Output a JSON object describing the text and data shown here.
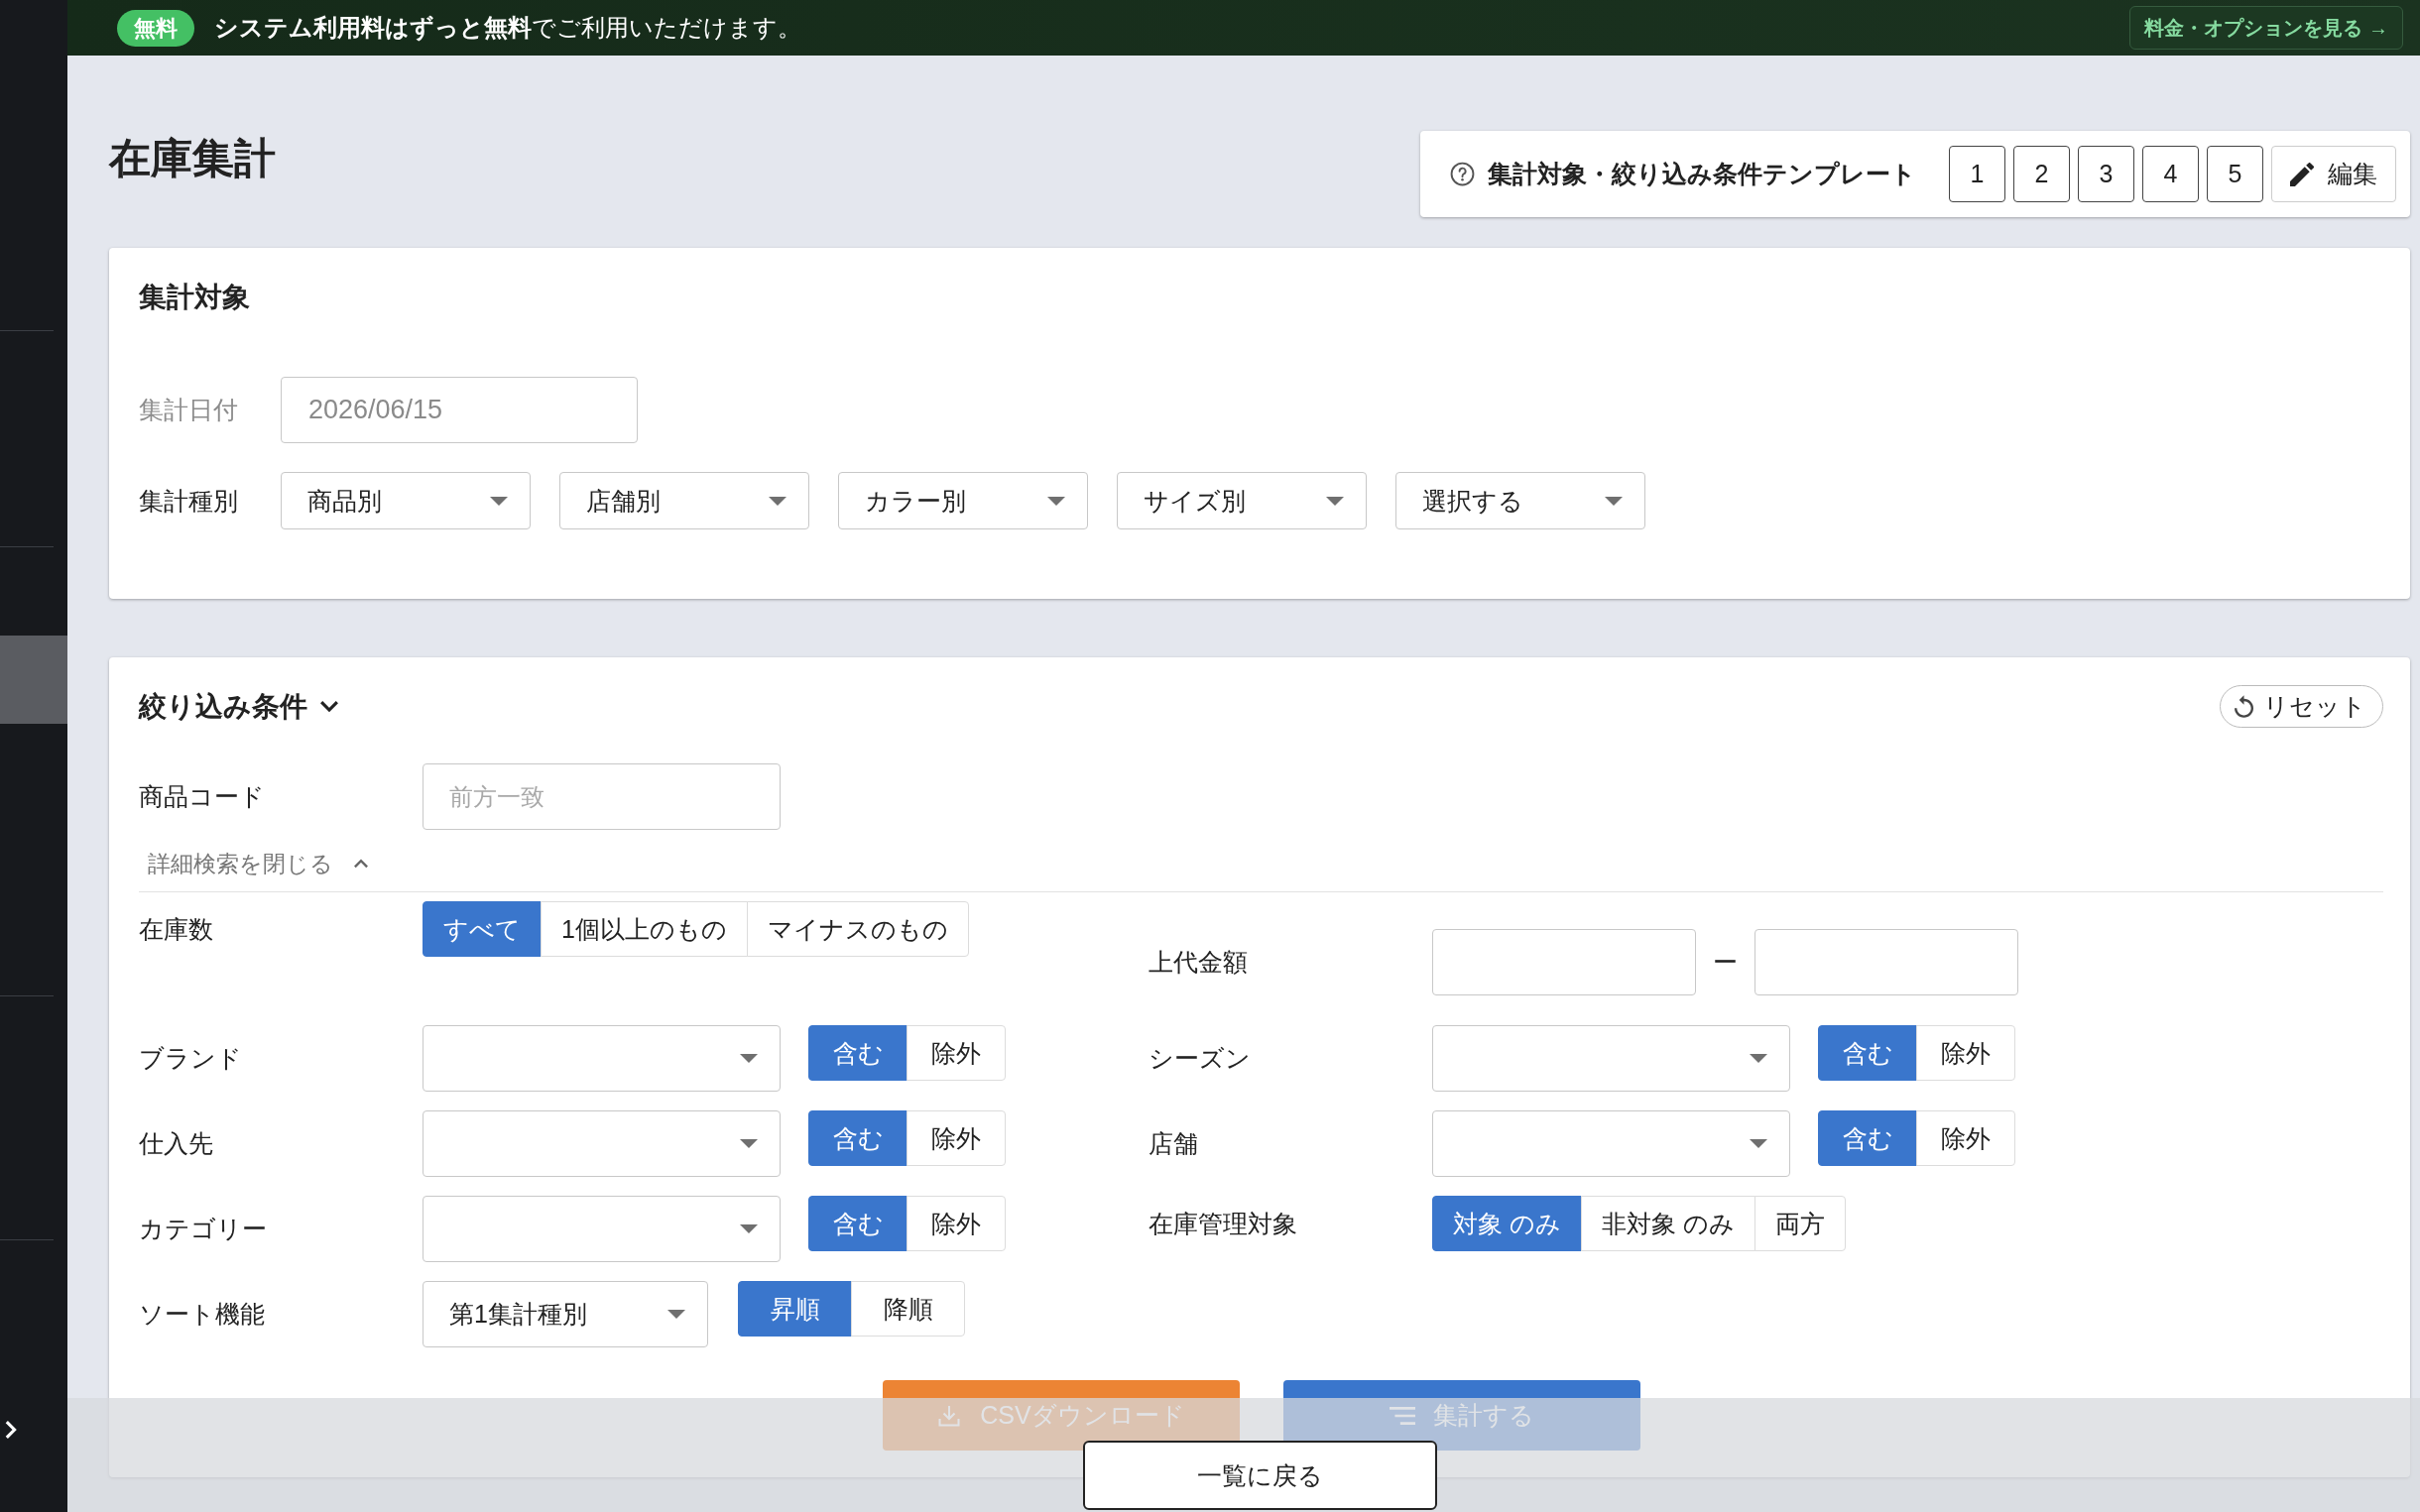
{
  "sidebar": {
    "expanded": false
  },
  "banner": {
    "badge": "無料",
    "message": "**システム利用料はずっと無料**でご利用いただけます。",
    "link": "料金・オプションを見る →"
  },
  "page": {
    "title": "在庫集計"
  },
  "template_panel": {
    "label": "集計対象・絞り込み条件テンプレート",
    "slots": [
      "1",
      "2",
      "3",
      "4",
      "5"
    ],
    "edit_button": "編集"
  },
  "target_card": {
    "title": "集計対象",
    "date": {
      "label": "集計日付",
      "value": "2026/06/15",
      "disabled": true
    },
    "type": {
      "label": "集計種別",
      "selects": [
        "商品別",
        "店舗別",
        "カラー別",
        "サイズ別",
        "選択する"
      ]
    }
  },
  "filter_card": {
    "title": "絞り込み条件",
    "expanded": true,
    "reset_button": "リセット",
    "product_code": {
      "label": "商品コード",
      "placeholder": "前方一致"
    },
    "detail_toggle": {
      "label": "詳細検索を閉じる",
      "expanded": true
    },
    "left_fields": [
      {
        "kind": "segmented",
        "label": "在庫数",
        "options": [
          {
            "label": "すべて",
            "selected": true
          },
          {
            "label": "1個以上のもの",
            "selected": false
          },
          {
            "label": "マイナスのもの",
            "selected": false
          }
        ]
      },
      {
        "kind": "select_toggle",
        "label": "ブランド",
        "options": [
          {
            "label": "含む",
            "selected": true
          },
          {
            "label": "除外",
            "selected": false
          }
        ]
      },
      {
        "kind": "select_toggle",
        "label": "仕入先",
        "options": [
          {
            "label": "含む",
            "selected": true
          },
          {
            "label": "除外",
            "selected": false
          }
        ]
      },
      {
        "kind": "select_toggle",
        "label": "カテゴリー",
        "options": [
          {
            "label": "含む",
            "selected": true
          },
          {
            "label": "除外",
            "selected": false
          }
        ]
      },
      {
        "kind": "sort",
        "label": "ソート機能",
        "value": "第1集計種別",
        "options": [
          {
            "label": "昇順",
            "selected": true
          },
          {
            "label": "降順",
            "selected": false
          }
        ]
      }
    ],
    "right_fields": [
      {
        "kind": "range",
        "label": "上代金額",
        "separator": "ー"
      },
      {
        "kind": "select_toggle",
        "label": "シーズン",
        "options": [
          {
            "label": "含む",
            "selected": true
          },
          {
            "label": "除外",
            "selected": false
          }
        ]
      },
      {
        "kind": "select_toggle",
        "label": "店舗",
        "options": [
          {
            "label": "含む",
            "selected": true
          },
          {
            "label": "除外",
            "selected": false
          }
        ]
      },
      {
        "kind": "segmented",
        "label": "在庫管理対象",
        "options": [
          {
            "label": "対象 のみ",
            "selected": true
          },
          {
            "label": "非対象 のみ",
            "selected": false
          },
          {
            "label": "両方",
            "selected": false
          }
        ]
      }
    ]
  },
  "actions": [
    {
      "kind": "download",
      "label": "CSVダウンロード"
    },
    {
      "kind": "aggregate",
      "label": "集計する"
    }
  ],
  "footer": {
    "back_button": "一覧に戻る"
  }
}
